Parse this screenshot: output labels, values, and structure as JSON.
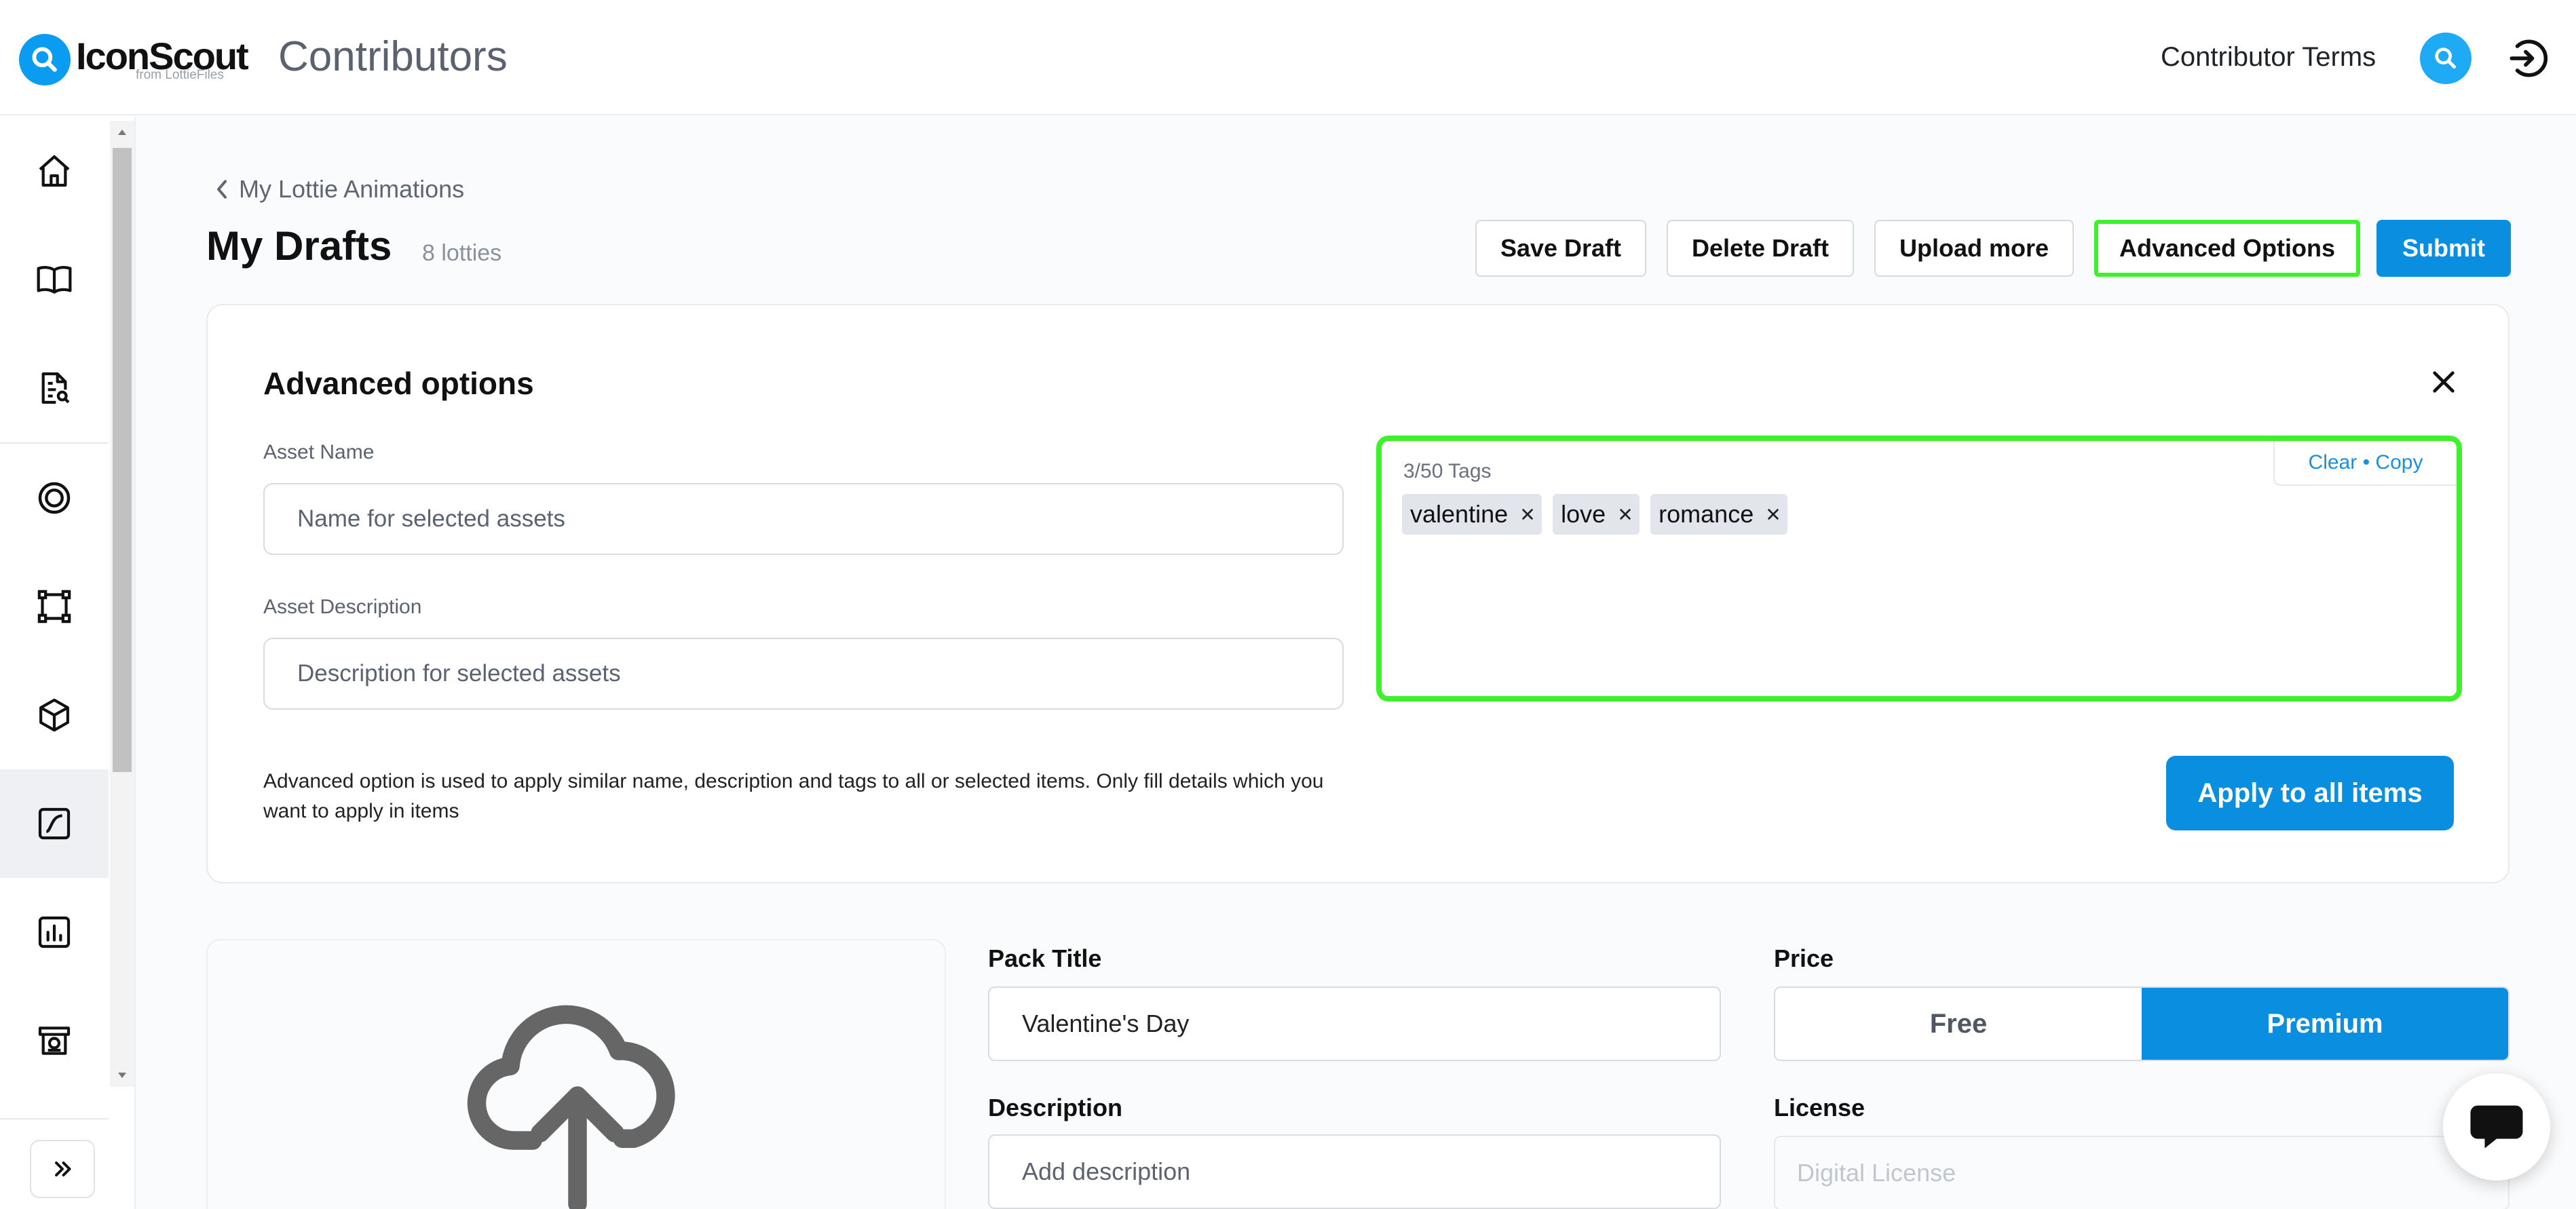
{
  "header": {
    "logo_word": "IconScout",
    "logo_sub": "from LottieFiles",
    "app_title": "Contributors",
    "terms_label": "Contributor Terms"
  },
  "sidebar": {
    "items": [
      {
        "icon": "home-icon"
      },
      {
        "icon": "book-icon"
      },
      {
        "icon": "document-search-icon"
      },
      {
        "icon": "target-icon"
      },
      {
        "icon": "vector-icon"
      },
      {
        "icon": "cube-icon"
      },
      {
        "icon": "animation-icon",
        "active": true
      },
      {
        "icon": "chart-icon"
      },
      {
        "icon": "payout-icon"
      }
    ],
    "expand_icon": "chevron-double-right-icon"
  },
  "breadcrumb": {
    "label": "My Lottie Animations"
  },
  "page": {
    "title": "My Drafts",
    "count": "8 lotties"
  },
  "toolbar": {
    "save_label": "Save Draft",
    "delete_label": "Delete Draft",
    "upload_label": "Upload more",
    "advanced_label": "Advanced Options",
    "submit_label": "Submit"
  },
  "advanced": {
    "title": "Advanced options",
    "name_label": "Asset Name",
    "name_placeholder": "Name for selected assets",
    "desc_label": "Asset Description",
    "desc_placeholder": "Description for selected assets",
    "tags_count": "3/50 Tags",
    "clear_label": "Clear",
    "copy_separator": " • ",
    "copy_label": "Copy",
    "tags": [
      "valentine",
      "love",
      "romance"
    ],
    "help_text": "Advanced option is used to apply similar name, description and tags to all or selected items. Only fill details which you want to apply in items",
    "apply_label": "Apply to all items"
  },
  "pack": {
    "title_label": "Pack Title",
    "title_value": "Valentine's Day",
    "description_label": "Description",
    "description_placeholder": "Add description",
    "price_label": "Price",
    "price_free": "Free",
    "price_premium": "Premium",
    "price_selected": "Premium",
    "license_label": "License",
    "license_placeholder": "Digital License"
  },
  "colors": {
    "accent": "#0a8fe0",
    "highlight": "#3df22b"
  }
}
